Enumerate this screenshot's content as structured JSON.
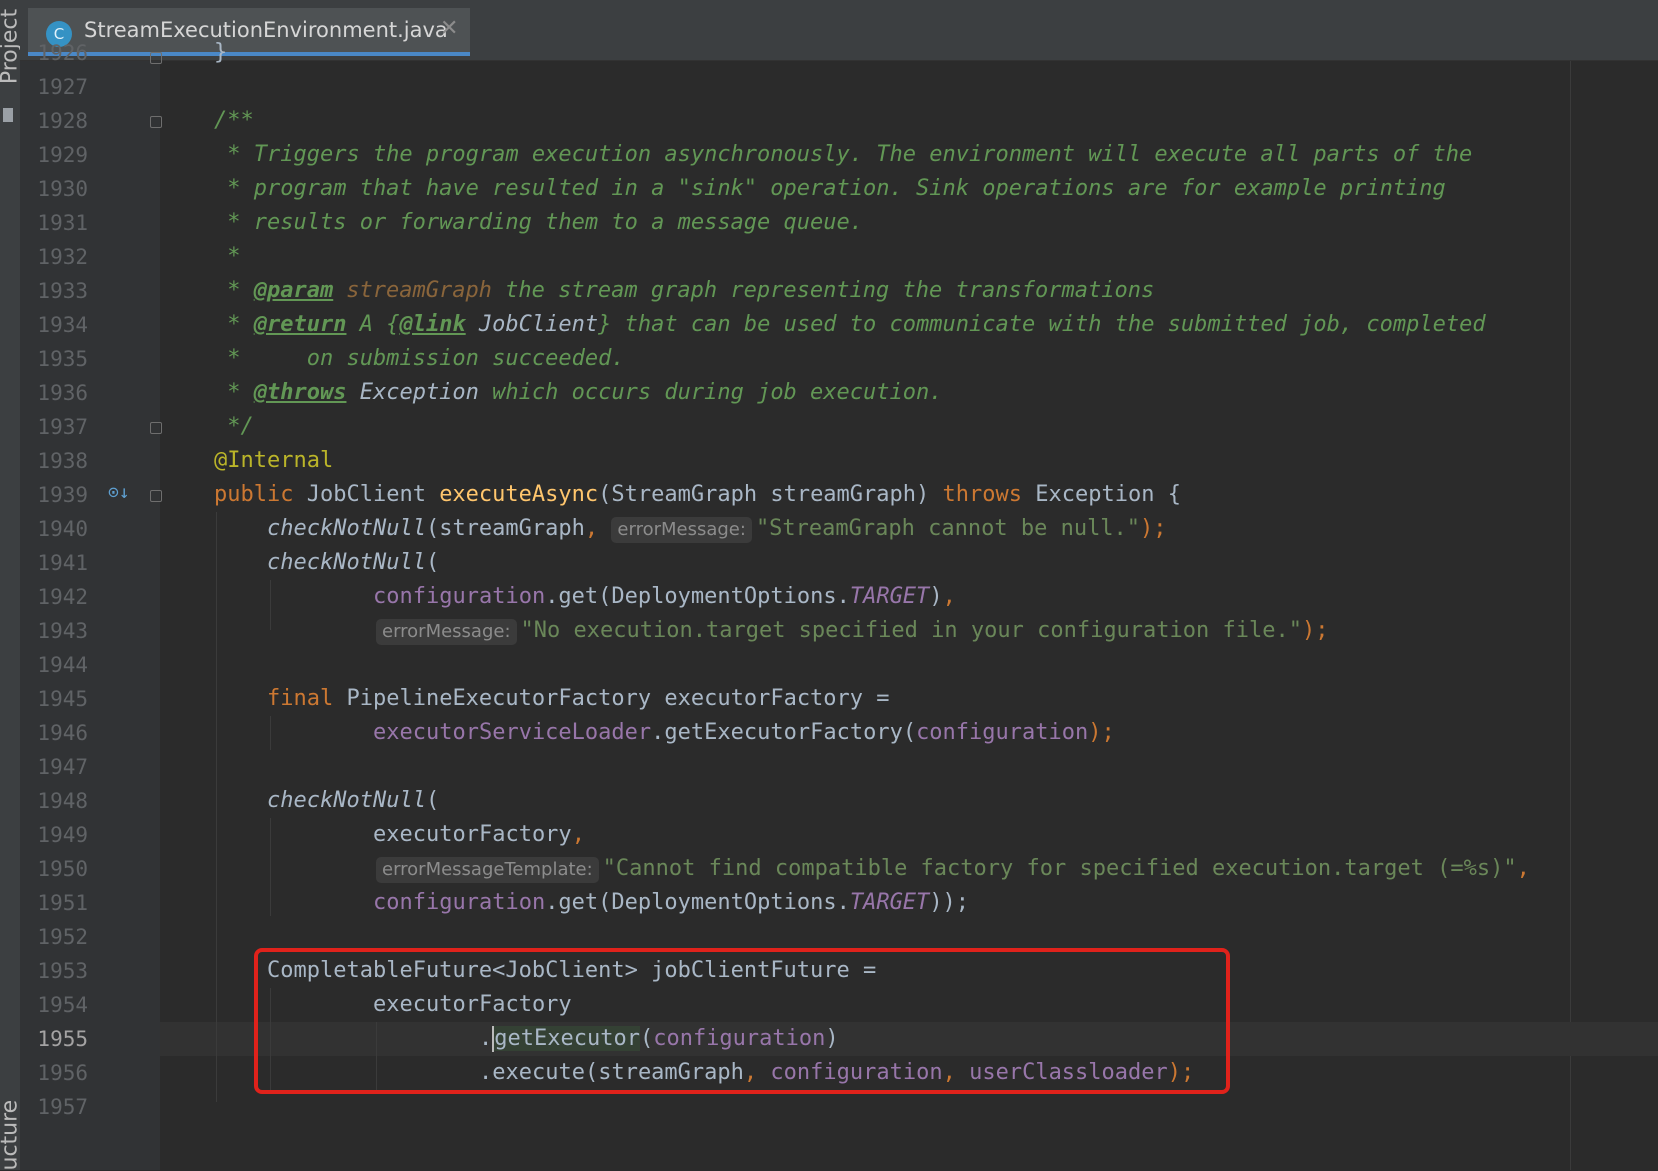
{
  "sidebar": {
    "project_label": "Project",
    "structure_label": "ucture"
  },
  "tab": {
    "icon_letter": "C",
    "filename": "StreamExecutionEnvironment.java",
    "close": "✕"
  },
  "line_numbers": [
    "1926",
    "1927",
    "1928",
    "1929",
    "1930",
    "1931",
    "1932",
    "1933",
    "1934",
    "1935",
    "1936",
    "1937",
    "1938",
    "1939",
    "1940",
    "1941",
    "1942",
    "1943",
    "1944",
    "1945",
    "1946",
    "1947",
    "1948",
    "1949",
    "1950",
    "1951",
    "1952",
    "1953",
    "1954",
    "1955",
    "1956",
    "1957"
  ],
  "current_line": "1955",
  "code": {
    "l1926": "}",
    "doc_open": "/**",
    "doc_1929": " * Triggers the program execution asynchronously. The environment will execute all parts of the",
    "doc_1930": " * program that have resulted in a \"sink\" operation. Sink operations are for example printing",
    "doc_1931": " * results or forwarding them to a message queue.",
    "doc_1932": " *",
    "doc_star": " * ",
    "tag_param": "@param",
    "param_name": "streamGraph",
    "param_desc": " the stream graph representing the transformations",
    "tag_return": "@return",
    "return_a": " A {",
    "tag_link": "@link",
    "link_ref": " JobClient",
    "return_desc": "} that can be used to communicate with the submitted job, completed",
    "doc_1935": " *     on submission succeeded.",
    "tag_throws": "@throws",
    "throws_ref": " Exception",
    "throws_desc": " which occurs during job execution.",
    "doc_close": " */",
    "annotation": "@Internal",
    "kw_public": "public",
    "type_jobclient": " JobClient ",
    "fn_executeAsync": "executeAsync",
    "sig_params": "(StreamGraph streamGraph) ",
    "kw_throws": "throws",
    "sig_tail": " Exception {",
    "checkNotNull": "checkNotNull",
    "l1940_args": "(streamGraph",
    "comma": ",",
    "hint_errorMessage": "errorMessage:",
    "str_1940": "\"StreamGraph cannot be null.\"",
    "close_paren_semi": ");",
    "open_paren": "(",
    "field_configuration": "configuration",
    "get_deployment": ".get(DeploymentOptions.",
    "const_target": "TARGET",
    "close_paren": ")",
    "str_1943": "\"No execution.target specified in your configuration file.\"",
    "kw_final": "final",
    "l1945_rest": " PipelineExecutorFactory executorFactory =",
    "field_loader": "executorServiceLoader",
    "get_factory": ".getExecutorFactory(",
    "executorFactory": "executorFactory",
    "hint_errorMessageTemplate": "errorMessageTemplate:",
    "str_1950": "\"Cannot find compatible factory for specified execution.target (=%s)\"",
    "close_double_semi": "));",
    "l1953": "CompletableFuture<JobClient> jobClientFuture =",
    "dot": ".",
    "getExecutor": "getExecutor",
    "execute_open": ".execute(streamGraph",
    "field_userClassloader": "userClassloader"
  },
  "colors": {
    "background": "#2b2b2b",
    "gutter": "#313335",
    "doc_comment": "#629755",
    "keyword": "#cc7832",
    "method_decl": "#ffc66d",
    "field": "#9876aa",
    "string": "#6a8759",
    "annotation": "#bbb529",
    "highlight_box": "#e0221b"
  }
}
